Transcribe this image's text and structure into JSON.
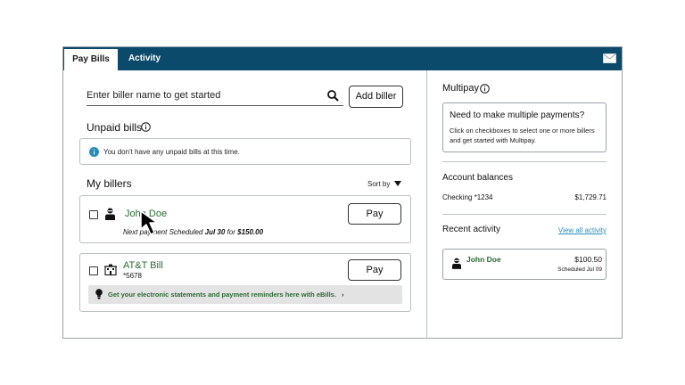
{
  "tabs": [
    {
      "label": "Pay Bills",
      "active": true
    },
    {
      "label": "Activity",
      "active": false
    }
  ],
  "search": {
    "placeholder": "Enter biller name to get started",
    "value": ""
  },
  "add_biller_label": "Add biller",
  "unpaid": {
    "title": "Unpaid bills",
    "message": "You don't have any unpaid bills at this time."
  },
  "my_billers": {
    "title": "My billers",
    "sort_label": "Sort by",
    "items": [
      {
        "name": "John Doe",
        "detail_prefix": "Next payment Scheduled",
        "detail_date": "Jul 30",
        "detail_mid": "for",
        "detail_amount": "$150.00",
        "pay_label": "Pay"
      },
      {
        "name": "AT&T Bill",
        "account": "*5678",
        "pay_label": "Pay",
        "ebills_text": "Get your electronic statements and payment reminders here with eBills.",
        "ebills_chevron": "›"
      }
    ]
  },
  "multipay": {
    "title": "Multipay",
    "box_heading": "Need to make multiple payments?",
    "box_body": "Click on checkboxes to select one or more billers and get started with Multipay."
  },
  "account_balances": {
    "title": "Account balances",
    "account_name": "Checking *1234",
    "balance": "$1,729.71"
  },
  "recent_activity": {
    "title": "Recent activity",
    "view_all": "View all activity",
    "items": [
      {
        "name": "John Doe",
        "amount": "$100.50",
        "status": "Scheduled Jul 09"
      }
    ]
  },
  "colors": {
    "topbar": "#0c4a6b",
    "biller_link": "#2b6a34",
    "info_blue": "#2a8fb8",
    "link_blue": "#2a8fb8"
  },
  "icons": [
    "mail-icon",
    "search-icon",
    "info-icon",
    "person-icon",
    "building-icon",
    "lightbulb-icon",
    "chevron-down-icon",
    "cursor-arrow-icon"
  ]
}
